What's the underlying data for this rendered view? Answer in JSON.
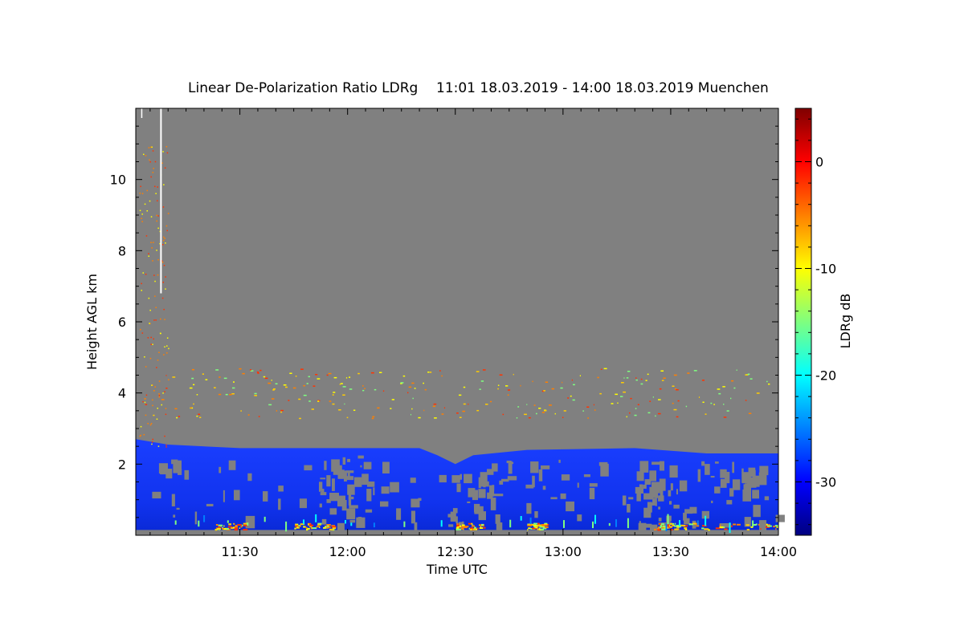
{
  "chart_data": {
    "type": "heatmap",
    "title": "Linear De-Polarization Ratio LDRg",
    "subtitle": "11:01 18.03.2019 - 14:00 18.03.2019 Muenchen",
    "xlabel": "Time UTC",
    "ylabel": "Height AGL km",
    "colorbar_label": "LDRg dB",
    "x_ticks": [
      "11:30",
      "12:00",
      "12:30",
      "13:00",
      "13:30",
      "14:00"
    ],
    "x_tick_minutes": [
      690,
      720,
      750,
      780,
      810,
      840
    ],
    "xlim_minutes": [
      661,
      840
    ],
    "y_ticks": [
      2,
      4,
      6,
      8,
      10
    ],
    "ylim": [
      0,
      12
    ],
    "colorbar_ticks": [
      0,
      -10,
      -20,
      -30
    ],
    "colorbar_range": [
      -35,
      5
    ],
    "colormap": [
      "#00007f",
      "#0000ff",
      "#007fff",
      "#00ffff",
      "#7fff7f",
      "#ffff00",
      "#ff7f00",
      "#ff0000",
      "#7f0000"
    ],
    "missing_color": "#808080",
    "echo_top_km": [
      {
        "minute": 661,
        "height": 2.7
      },
      {
        "minute": 670,
        "height": 2.55
      },
      {
        "minute": 690,
        "height": 2.45
      },
      {
        "minute": 720,
        "height": 2.45
      },
      {
        "minute": 740,
        "height": 2.45
      },
      {
        "minute": 745,
        "height": 2.25
      },
      {
        "minute": 750,
        "height": 2.0
      },
      {
        "minute": 755,
        "height": 2.25
      },
      {
        "minute": 770,
        "height": 2.4
      },
      {
        "minute": 800,
        "height": 2.45
      },
      {
        "minute": 820,
        "height": 2.3
      },
      {
        "minute": 840,
        "height": 2.3
      }
    ]
  }
}
